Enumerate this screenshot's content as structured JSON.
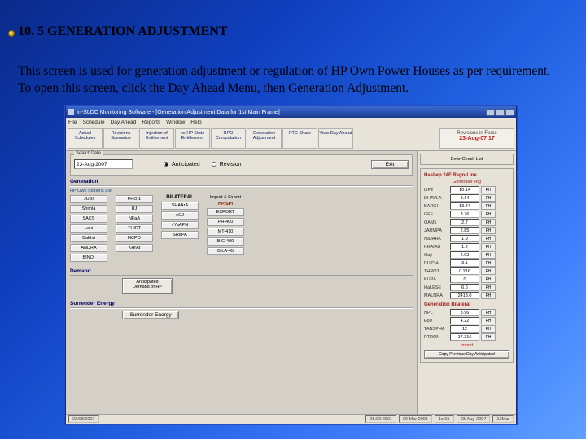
{
  "slide": {
    "heading": "10. 5 GENERATION ADJUSTMENT",
    "body": "This screen is used for generation adjustment or regulation of HP Own Power Houses as per requirement. To open this screen, click the Day Ahead Menu, then Generation Adjustment."
  },
  "window": {
    "title": "In-SLDC Monitoring Software - [Generation Adjustment Data for 1st Main Frame]",
    "menus": [
      "File",
      "Schedule",
      "Day Ahead",
      "Reports",
      "Window",
      "Help"
    ],
    "toolbar": [
      "Actual Schedules",
      "Revisions Scenarios",
      "Injection of Entitlement",
      "ex-HP State Entitlement",
      "RPO Computation",
      "Generation Adjustment",
      "PTC Share",
      "View Day Ahead"
    ],
    "toolbar_date_label": "Revisions in Force",
    "toolbar_date": "23-Aug-07   17",
    "select_date": {
      "title": "Select Date",
      "value": "23-Aug-2007",
      "radio1": "Anticipated",
      "radio2": "Revision",
      "exit": "Exit"
    },
    "generation": {
      "title": "Generation",
      "subhead": "HP Own Stations List",
      "col1": [
        "JUBI",
        "Shimla",
        "SACS",
        "Loki",
        "Bakhri",
        "ANDRA",
        "BINOI"
      ],
      "col2": [
        "FHO 1",
        "RJ",
        "NFaA",
        "THIRT",
        "HCPO",
        "KHrAt",
        ""
      ],
      "bilateral_head": "BILATERAL",
      "col3": [
        "SHAArA",
        "eOJ",
        "vYaAPN",
        "SRaPA"
      ],
      "impexp_head": "Import & Export",
      "impexp_sub": "HP/SPI",
      "col4": [
        "EXPORT",
        "PH-400",
        "MT-410",
        "BIG-400",
        "BILA-45"
      ]
    },
    "demand": {
      "title": "Demand",
      "btn": "Anticipated Demand of HP"
    },
    "surrender": {
      "title": "Surrender Energy",
      "btn": "Surrender Energy"
    },
    "rightpane": {
      "box1": "Error Check List",
      "head1": "Hashep 24F Regn-Line",
      "sub1": "Generator Rtg",
      "rows1": [
        {
          "l": "LIP2",
          "v": "10.14"
        },
        {
          "l": "DHAVLA",
          "v": "8.14"
        },
        {
          "l": "BARGI",
          "v": "13.44"
        },
        {
          "l": "GFF",
          "v": "3.76"
        },
        {
          "l": "QAM1",
          "v": "2.7"
        },
        {
          "l": "JARMPA",
          "v": "2.85"
        },
        {
          "l": "NaJARK",
          "v": "1.9"
        },
        {
          "l": "KHAIAU",
          "v": "1.2"
        },
        {
          "l": "Gaji",
          "v": "2.03"
        },
        {
          "l": "PHIPuL",
          "v": "3.1"
        },
        {
          "l": "THROT",
          "v": "0.216"
        },
        {
          "l": "KUP&",
          "v": "0"
        },
        {
          "l": "HaLESE",
          "v": "6.6"
        },
        {
          "l": "MALNRA",
          "v": "2413.0"
        }
      ],
      "head2": "Generation Bilateral",
      "rows2": [
        {
          "l": "NPL",
          "v": "3.96"
        },
        {
          "l": "E80",
          "v": "4.22"
        },
        {
          "l": "TANSPHA",
          "v": "12"
        },
        {
          "l": "PTRON",
          "v": "17.316"
        }
      ],
      "import_label": "Import",
      "copy_btn": "Copy Previous Day Anticipated"
    },
    "statusbar": [
      "23/08/2007",
      "",
      "05:00:2001",
      "06 Mar 2001",
      "1o 01",
      "23-Aug-2007",
      "12Mar"
    ]
  }
}
